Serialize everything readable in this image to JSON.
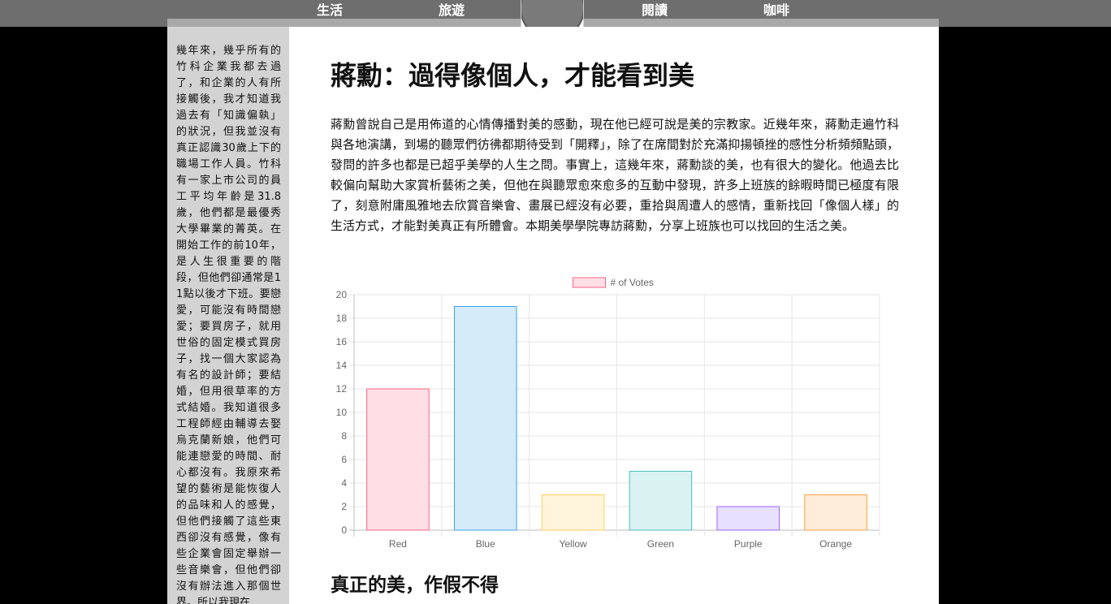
{
  "nav": {
    "items": [
      "生活",
      "旅遊",
      "閱讀",
      "咖啡"
    ]
  },
  "sidebar": {
    "text": "幾年來，幾乎所有的竹科企業我都去過了，和企業的人有所接觸後，我才知道我過去有「知識偏執」的狀況，但我並沒有真正認識30歲上下的職場工作人員。竹科有一家上市公司的員工平均年齡是31.8歲，他們都是最優秀大學畢業的菁英。在開始工作的前10年，是人生很重要的階段，但他們卻通常是11點以後才下班。要戀愛，可能沒有時間戀愛；要買房子，就用世俗的固定模式買房子，找一個大家認為有名的設計師；要結婚，但用很草率的方式結婚。我知道很多工程師經由輔導去娶烏克蘭新娘，他們可能連戀愛的時間、耐心都沒有。我原來希望的藝術是能恢復人的品味和人的感覺，但他們接觸了這些東西卻沒有感覺，像有些企業會固定舉辦一些音樂會，但他們卻沒有辦法進入那個世界。所以我現在"
  },
  "article": {
    "title": "蔣勳：過得像個人，才能看到美",
    "intro": "蔣勳曾說自己是用佈道的心情傳播對美的感動，現在他已經可說是美的宗教家。近幾年來，蔣勳走遍竹科與各地演講，到場的聽眾們彷彿都期待受到「開釋」，除了在席間對於充滿抑揚頓挫的感性分析頻頻點頭，發問的許多也都是已超乎美學的人生之問。事實上，這幾年來，蔣勳談的美，也有很大的變化。他過去比較偏向幫助大家賞析藝術之美，但他在與聽眾愈來愈多的互動中發現，許多上班族的餘暇時間已極度有限了，刻意附庸風雅地去欣賞音樂會、畫展已經沒有必要，重拾與周遭人的感情，重新找回「像個人樣」的生活方式，才能對美真正有所體會。本期美學學院專訪蔣勳，分享上班族也可以找回的生活之美。",
    "section_title": "真正的美，作假不得"
  },
  "chart_data": {
    "type": "bar",
    "categories": [
      "Red",
      "Blue",
      "Yellow",
      "Green",
      "Purple",
      "Orange"
    ],
    "series": [
      {
        "name": "# of Votes",
        "values": [
          12,
          19,
          3,
          5,
          2,
          3
        ]
      }
    ],
    "ylim": [
      0,
      20
    ],
    "yticks": [
      0,
      2,
      4,
      6,
      8,
      10,
      12,
      14,
      16,
      18,
      20
    ],
    "legend": "top-center",
    "grid": true,
    "colors": {
      "fill": [
        "#ffdfe5",
        "#d6ebf9",
        "#fff4dc",
        "#daf2f2",
        "#e8e0ff",
        "#ffecd9"
      ],
      "stroke": [
        "#ff6384",
        "#36a2eb",
        "#ffce56",
        "#4bc0c0",
        "#9966ff",
        "#ff9f40"
      ]
    }
  }
}
